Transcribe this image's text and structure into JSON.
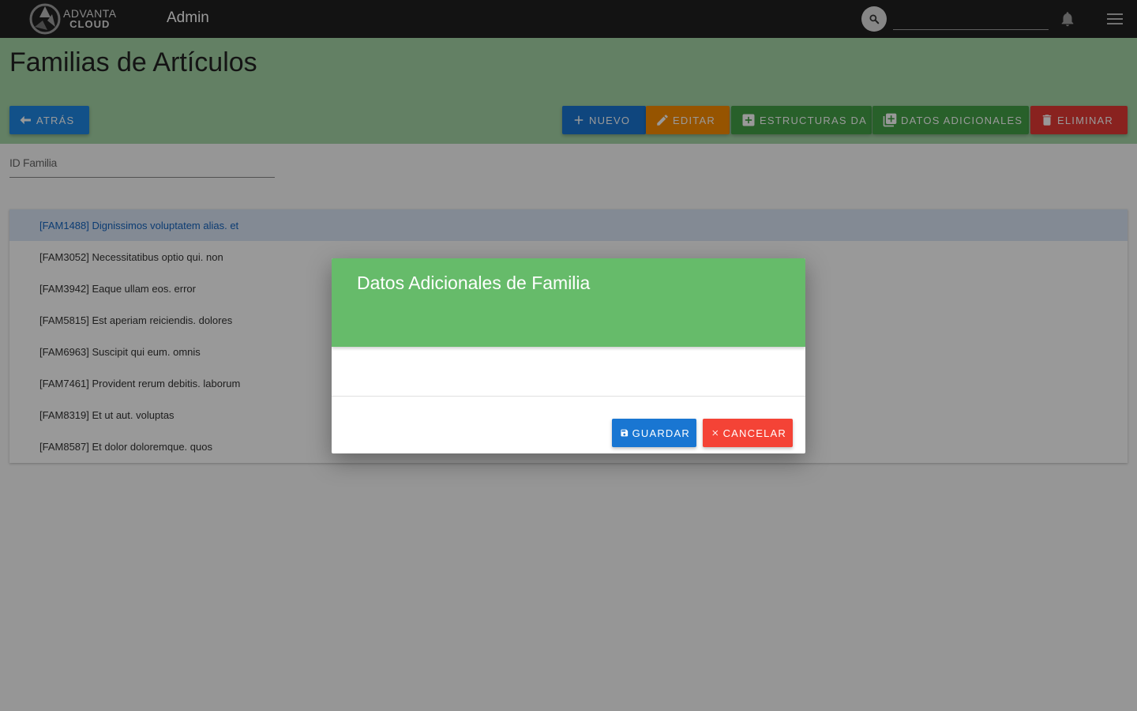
{
  "topbar": {
    "logo_line1": "ADVANTA",
    "logo_line2": "CLOUD",
    "app_title": "Admin",
    "search_placeholder": ""
  },
  "page": {
    "title": "Familias de Artículos"
  },
  "toolbar": {
    "back_label": "ATRÁS",
    "new_label": "NUEVO",
    "edit_label": "EDITAR",
    "structures_label": "ESTRUCTURAS DA",
    "additional_data_label": "DATOS ADICIONALES",
    "delete_label": "ELIMINAR"
  },
  "filter": {
    "label": "ID Familia"
  },
  "list": {
    "items": [
      {
        "label": "[FAM1488] Dignissimos voluptatem alias. et",
        "selected": true
      },
      {
        "label": "[FAM3052] Necessitatibus optio qui. non"
      },
      {
        "label": "[FAM3942] Eaque ullam eos. error"
      },
      {
        "label": "[FAM5815] Est aperiam reiciendis. dolores"
      },
      {
        "label": "[FAM6963] Suscipit qui eum. omnis"
      },
      {
        "label": "[FAM7461] Provident rerum debitis. laborum"
      },
      {
        "label": "[FAM8319] Et ut aut. voluptas"
      },
      {
        "label": "[FAM8587] Et dolor doloremque. quos"
      }
    ]
  },
  "dialog": {
    "title": "Datos Adicionales de Familia",
    "save_label": "GUARDAR",
    "cancel_label": "CANCELAR"
  },
  "colors": {
    "topbar": "#212121",
    "header_green": "#a5d6a7",
    "dialog_green": "#66bb6a",
    "primary_blue": "#1976d2",
    "warning_orange": "#fb8c00",
    "success_green": "#43a047",
    "danger_red": "#e53935"
  }
}
